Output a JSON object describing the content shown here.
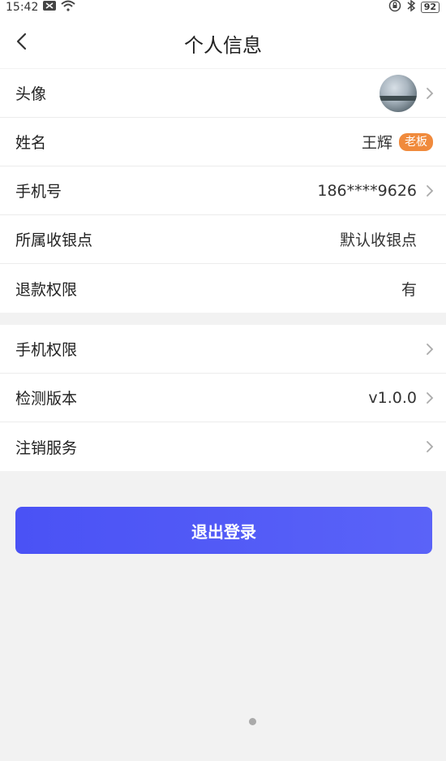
{
  "status_bar": {
    "time": "15:42",
    "battery": "92"
  },
  "header": {
    "title": "个人信息"
  },
  "profile": {
    "avatar_label": "头像",
    "name_label": "姓名",
    "name_value": "王辉",
    "role_badge": "老板",
    "phone_label": "手机号",
    "phone_value": "186****9626",
    "register_label": "所属收银点",
    "register_value": "默认收银点",
    "refund_label": "退款权限",
    "refund_value": "有"
  },
  "settings": {
    "permissions_label": "手机权限",
    "version_label": "检测版本",
    "version_value": "v1.0.0",
    "cancel_label": "注销服务"
  },
  "logout": {
    "label": "退出登录"
  },
  "colors": {
    "accent": "#4a52f5",
    "badge": "#f08a3c",
    "background": "#f2f2f2"
  }
}
